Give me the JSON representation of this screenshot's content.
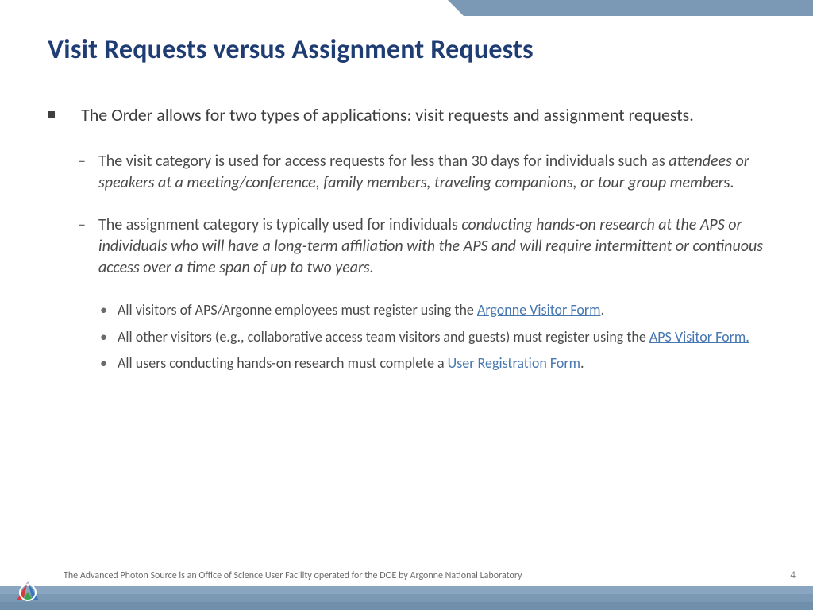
{
  "title": "Visit Requests versus Assignment Requests",
  "bullets": {
    "lvl1": "The Order allows for two types of applications:  visit requests and assignment requests.",
    "visit_a": "The visit category is used for access requests for less than 30 days for individuals such as ",
    "visit_b_ital": "attendees or speakers at a meeting/conference, family members, traveling companions, or tour group member",
    "visit_c": "s.",
    "assign_a": "The assignment category is typically used for individuals ",
    "assign_b_ital": "conducting hands-on research at the APS or individuals who will have a long-term affiliation with the APS and will require intermittent or continuous access over a time span of up to two years.",
    "sub1_a": "All visitors of APS/Argonne employees must register using the ",
    "sub1_link": "Argonne Visitor Form",
    "sub1_b": ".",
    "sub2_a": "All other visitors (e.g., collaborative access team visitors and guests) must register using the ",
    "sub2_link": "APS Visitor Form.",
    "sub3_a": "All users conducting hands-on research must complete a ",
    "sub3_link": "User Registration Form",
    "sub3_b": "."
  },
  "footer": "The Advanced Photon Source is an Office of Science User Facility operated for the DOE by Argonne National Laboratory",
  "page": "4"
}
